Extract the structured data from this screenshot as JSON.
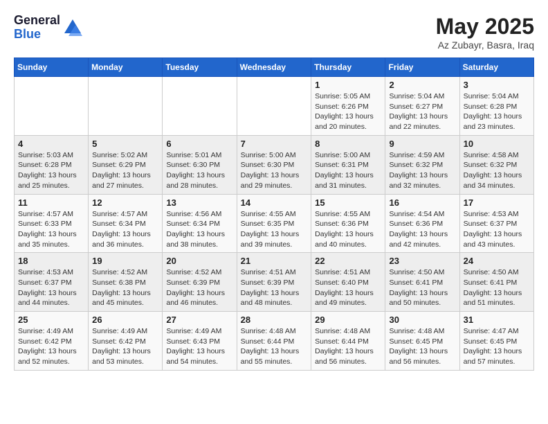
{
  "header": {
    "logo_general": "General",
    "logo_blue": "Blue",
    "title": "May 2025",
    "location": "Az Zubayr, Basra, Iraq"
  },
  "weekdays": [
    "Sunday",
    "Monday",
    "Tuesday",
    "Wednesday",
    "Thursday",
    "Friday",
    "Saturday"
  ],
  "weeks": [
    [
      {
        "day": "",
        "info": ""
      },
      {
        "day": "",
        "info": ""
      },
      {
        "day": "",
        "info": ""
      },
      {
        "day": "",
        "info": ""
      },
      {
        "day": "1",
        "info": "Sunrise: 5:05 AM\nSunset: 6:26 PM\nDaylight: 13 hours\nand 20 minutes."
      },
      {
        "day": "2",
        "info": "Sunrise: 5:04 AM\nSunset: 6:27 PM\nDaylight: 13 hours\nand 22 minutes."
      },
      {
        "day": "3",
        "info": "Sunrise: 5:04 AM\nSunset: 6:28 PM\nDaylight: 13 hours\nand 23 minutes."
      }
    ],
    [
      {
        "day": "4",
        "info": "Sunrise: 5:03 AM\nSunset: 6:28 PM\nDaylight: 13 hours\nand 25 minutes."
      },
      {
        "day": "5",
        "info": "Sunrise: 5:02 AM\nSunset: 6:29 PM\nDaylight: 13 hours\nand 27 minutes."
      },
      {
        "day": "6",
        "info": "Sunrise: 5:01 AM\nSunset: 6:30 PM\nDaylight: 13 hours\nand 28 minutes."
      },
      {
        "day": "7",
        "info": "Sunrise: 5:00 AM\nSunset: 6:30 PM\nDaylight: 13 hours\nand 29 minutes."
      },
      {
        "day": "8",
        "info": "Sunrise: 5:00 AM\nSunset: 6:31 PM\nDaylight: 13 hours\nand 31 minutes."
      },
      {
        "day": "9",
        "info": "Sunrise: 4:59 AM\nSunset: 6:32 PM\nDaylight: 13 hours\nand 32 minutes."
      },
      {
        "day": "10",
        "info": "Sunrise: 4:58 AM\nSunset: 6:32 PM\nDaylight: 13 hours\nand 34 minutes."
      }
    ],
    [
      {
        "day": "11",
        "info": "Sunrise: 4:57 AM\nSunset: 6:33 PM\nDaylight: 13 hours\nand 35 minutes."
      },
      {
        "day": "12",
        "info": "Sunrise: 4:57 AM\nSunset: 6:34 PM\nDaylight: 13 hours\nand 36 minutes."
      },
      {
        "day": "13",
        "info": "Sunrise: 4:56 AM\nSunset: 6:34 PM\nDaylight: 13 hours\nand 38 minutes."
      },
      {
        "day": "14",
        "info": "Sunrise: 4:55 AM\nSunset: 6:35 PM\nDaylight: 13 hours\nand 39 minutes."
      },
      {
        "day": "15",
        "info": "Sunrise: 4:55 AM\nSunset: 6:36 PM\nDaylight: 13 hours\nand 40 minutes."
      },
      {
        "day": "16",
        "info": "Sunrise: 4:54 AM\nSunset: 6:36 PM\nDaylight: 13 hours\nand 42 minutes."
      },
      {
        "day": "17",
        "info": "Sunrise: 4:53 AM\nSunset: 6:37 PM\nDaylight: 13 hours\nand 43 minutes."
      }
    ],
    [
      {
        "day": "18",
        "info": "Sunrise: 4:53 AM\nSunset: 6:37 PM\nDaylight: 13 hours\nand 44 minutes."
      },
      {
        "day": "19",
        "info": "Sunrise: 4:52 AM\nSunset: 6:38 PM\nDaylight: 13 hours\nand 45 minutes."
      },
      {
        "day": "20",
        "info": "Sunrise: 4:52 AM\nSunset: 6:39 PM\nDaylight: 13 hours\nand 46 minutes."
      },
      {
        "day": "21",
        "info": "Sunrise: 4:51 AM\nSunset: 6:39 PM\nDaylight: 13 hours\nand 48 minutes."
      },
      {
        "day": "22",
        "info": "Sunrise: 4:51 AM\nSunset: 6:40 PM\nDaylight: 13 hours\nand 49 minutes."
      },
      {
        "day": "23",
        "info": "Sunrise: 4:50 AM\nSunset: 6:41 PM\nDaylight: 13 hours\nand 50 minutes."
      },
      {
        "day": "24",
        "info": "Sunrise: 4:50 AM\nSunset: 6:41 PM\nDaylight: 13 hours\nand 51 minutes."
      }
    ],
    [
      {
        "day": "25",
        "info": "Sunrise: 4:49 AM\nSunset: 6:42 PM\nDaylight: 13 hours\nand 52 minutes."
      },
      {
        "day": "26",
        "info": "Sunrise: 4:49 AM\nSunset: 6:42 PM\nDaylight: 13 hours\nand 53 minutes."
      },
      {
        "day": "27",
        "info": "Sunrise: 4:49 AM\nSunset: 6:43 PM\nDaylight: 13 hours\nand 54 minutes."
      },
      {
        "day": "28",
        "info": "Sunrise: 4:48 AM\nSunset: 6:44 PM\nDaylight: 13 hours\nand 55 minutes."
      },
      {
        "day": "29",
        "info": "Sunrise: 4:48 AM\nSunset: 6:44 PM\nDaylight: 13 hours\nand 56 minutes."
      },
      {
        "day": "30",
        "info": "Sunrise: 4:48 AM\nSunset: 6:45 PM\nDaylight: 13 hours\nand 56 minutes."
      },
      {
        "day": "31",
        "info": "Sunrise: 4:47 AM\nSunset: 6:45 PM\nDaylight: 13 hours\nand 57 minutes."
      }
    ]
  ]
}
